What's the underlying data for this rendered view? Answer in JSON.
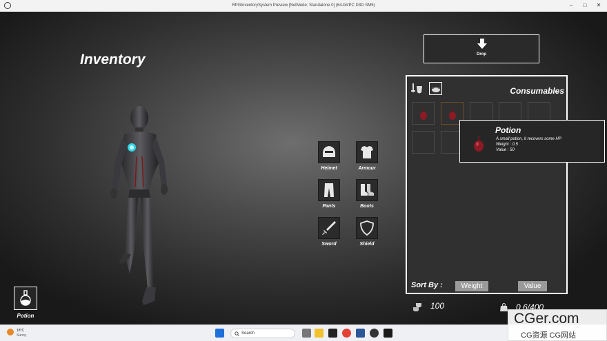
{
  "window": {
    "title": "RPGInventorySystem Preview [NetMode: Standalone 0]  (64-bit/PC D3D SM5)"
  },
  "inventory": {
    "title": "Inventory"
  },
  "equipment": [
    {
      "label": "Helmet",
      "icon": "helmet-icon"
    },
    {
      "label": "Armour",
      "icon": "armour-icon"
    },
    {
      "label": "Pants",
      "icon": "pants-icon"
    },
    {
      "label": "Boots",
      "icon": "boots-icon"
    },
    {
      "label": "Sword",
      "icon": "sword-icon"
    },
    {
      "label": "Shield",
      "icon": "shield-icon"
    }
  ],
  "drop_button": {
    "label": "Drop"
  },
  "panel": {
    "category_title": "Consumables",
    "tabs": [
      "weapons-tab-icon",
      "consumables-tab-icon"
    ],
    "sort_by_label": "Sort By :",
    "sort_weight": "Weight",
    "sort_value": "Value"
  },
  "tooltip": {
    "name": "Potion",
    "description": "A small potion, it recovers some HP",
    "weight": "Weight : 0.5",
    "value": "Value : 50"
  },
  "stats": {
    "gold": "100",
    "weight": "0.6/400"
  },
  "quick_slot": {
    "label": "Potion"
  },
  "taskbar": {
    "temperature": "18°C",
    "condition": "Sunny",
    "search_placeholder": "Search"
  },
  "watermark": {
    "line1": "CGer.com",
    "line2": "CG资源 CG网站"
  },
  "colors": {
    "potion": "#8b1a24",
    "accent_border": "#ffffff",
    "sort_button": "#9a9a9a",
    "character_light": "#2fd6e6"
  }
}
